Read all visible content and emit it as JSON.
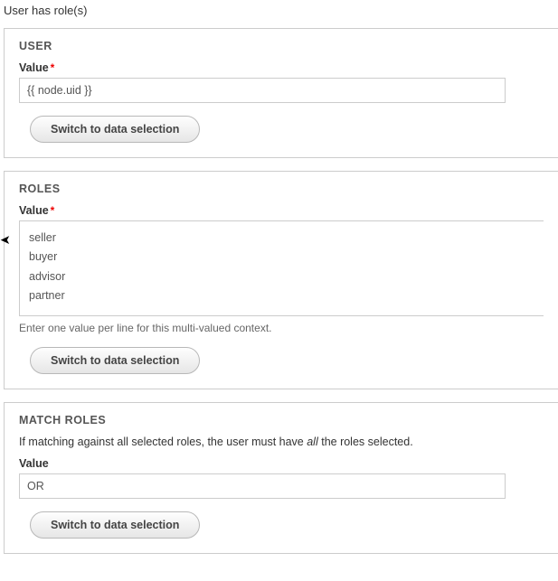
{
  "page_title": "User has role(s)",
  "user_section": {
    "title": "USER",
    "value_label": "Value",
    "required": true,
    "value": "{{ node.uid }}",
    "switch_btn": "Switch to data selection"
  },
  "roles_section": {
    "title": "ROLES",
    "value_label": "Value",
    "required": true,
    "value": "seller\nbuyer\nadvisor\npartner",
    "help": "Enter one value per line for this multi-valued context.",
    "switch_btn": "Switch to data selection"
  },
  "match_section": {
    "title": "MATCH ROLES",
    "description_pre": "If matching against all selected roles, the user must have ",
    "description_em": "all ",
    "description_post": "the roles selected.",
    "value_label": "Value",
    "required": false,
    "value": "OR",
    "switch_btn": "Switch to data selection"
  }
}
